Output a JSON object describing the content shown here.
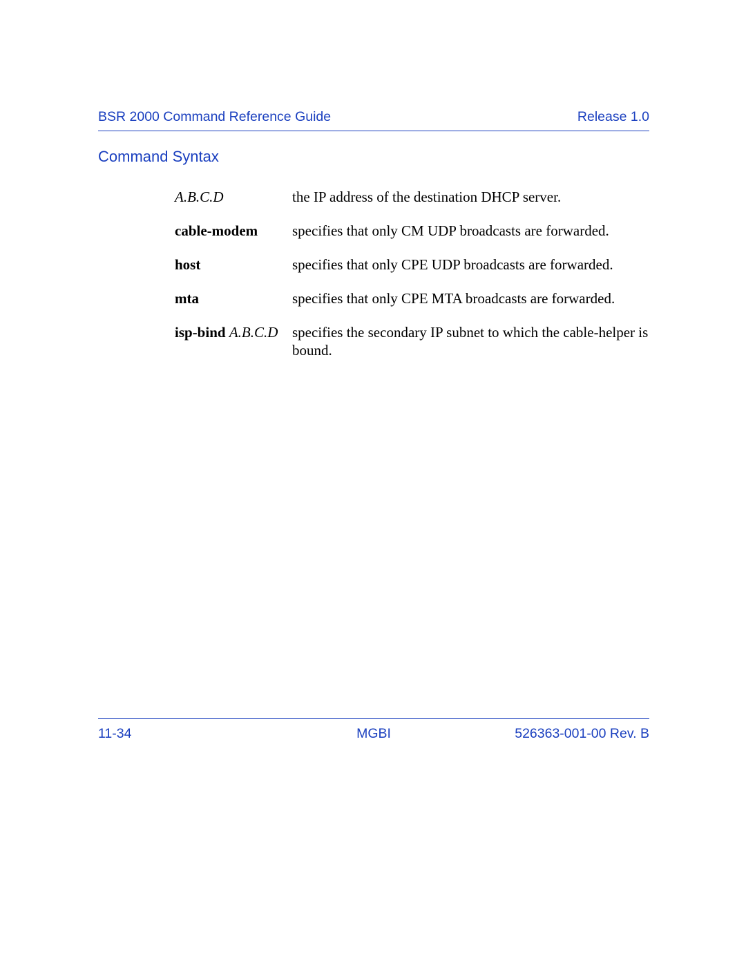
{
  "header": {
    "title": "BSR 2000 Command Reference Guide",
    "release": "Release 1.0"
  },
  "section_title": "Command Syntax",
  "params": [
    {
      "term": "A.B.C.D",
      "term_style": "italic",
      "desc": "the IP address of the destination DHCP server."
    },
    {
      "term": "cable-modem",
      "term_style": "bold",
      "desc": "specifies that only CM UDP broadcasts are forwarded."
    },
    {
      "term": "host",
      "term_style": "bold",
      "desc": "specifies that only CPE UDP broadcasts are forwarded."
    },
    {
      "term": "mta",
      "term_style": "bold",
      "desc": "specifies that only CPE MTA broadcasts are forwarded."
    },
    {
      "term_prefix": "isp-bind ",
      "term_suffix": "A.B.C.D",
      "term_style": "mixed",
      "desc": "specifies the secondary IP subnet to which the cable-helper is bound."
    }
  ],
  "footer": {
    "page_num": "11-34",
    "center": "MGBI",
    "doc_rev": "526363-001-00 Rev. B"
  }
}
